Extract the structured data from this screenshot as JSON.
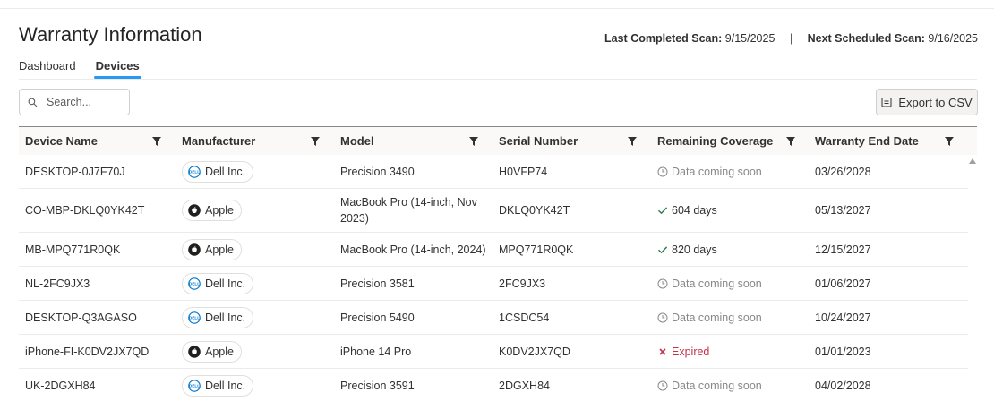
{
  "page": {
    "title": "Warranty Information",
    "last_scan_label": "Last Completed Scan:",
    "last_scan_value": "9/15/2025",
    "separator": "|",
    "next_scan_label": "Next Scheduled Scan:",
    "next_scan_value": "9/16/2025"
  },
  "tabs": [
    {
      "label": "Dashboard",
      "active": false
    },
    {
      "label": "Devices",
      "active": true
    }
  ],
  "toolbar": {
    "search_placeholder": "Search...",
    "export_label": "Export to CSV"
  },
  "table": {
    "columns": [
      "Device Name",
      "Manufacturer",
      "Model",
      "Serial Number",
      "Remaining Coverage",
      "Warranty End Date"
    ],
    "rows": [
      {
        "device": "DESKTOP-0J7F70J",
        "manufacturer": "Dell Inc.",
        "maker_icon": "dell-logo-icon",
        "model": "Precision 3490",
        "serial": "H0VFP74",
        "coverage": "Data coming soon",
        "coverage_status": "pending",
        "end_date": "03/26/2028"
      },
      {
        "device": "CO-MBP-DKLQ0YK42T",
        "manufacturer": "Apple",
        "maker_icon": "apple-logo-icon",
        "model": "MacBook Pro (14-inch, Nov 2023)",
        "serial": "DKLQ0YK42T",
        "coverage": "604 days",
        "coverage_status": "active",
        "end_date": "05/13/2027"
      },
      {
        "device": "MB-MPQ771R0QK",
        "manufacturer": "Apple",
        "maker_icon": "apple-logo-icon",
        "model": "MacBook Pro (14-inch, 2024)",
        "serial": "MPQ771R0QK",
        "coverage": "820 days",
        "coverage_status": "active",
        "end_date": "12/15/2027"
      },
      {
        "device": "NL-2FC9JX3",
        "manufacturer": "Dell Inc.",
        "maker_icon": "dell-logo-icon",
        "model": "Precision 3581",
        "serial": "2FC9JX3",
        "coverage": "Data coming soon",
        "coverage_status": "pending",
        "end_date": "01/06/2027"
      },
      {
        "device": "DESKTOP-Q3AGASO",
        "manufacturer": "Dell Inc.",
        "maker_icon": "dell-logo-icon",
        "model": "Precision 5490",
        "serial": "1CSDC54",
        "coverage": "Data coming soon",
        "coverage_status": "pending",
        "end_date": "10/24/2027"
      },
      {
        "device": "iPhone-FI-K0DV2JX7QD",
        "manufacturer": "Apple",
        "maker_icon": "apple-logo-icon",
        "model": "iPhone 14 Pro",
        "serial": "K0DV2JX7QD",
        "coverage": "Expired",
        "coverage_status": "expired",
        "end_date": "01/01/2023"
      },
      {
        "device": "UK-2DGXH84",
        "manufacturer": "Dell Inc.",
        "maker_icon": "dell-logo-icon",
        "model": "Precision 3591",
        "serial": "2DGXH84",
        "coverage": "Data coming soon",
        "coverage_status": "pending",
        "end_date": "04/02/2028"
      }
    ]
  },
  "colors": {
    "accent": "#2899f5",
    "success": "#237b4b",
    "danger": "#c4314b",
    "muted": "#8a8886"
  }
}
